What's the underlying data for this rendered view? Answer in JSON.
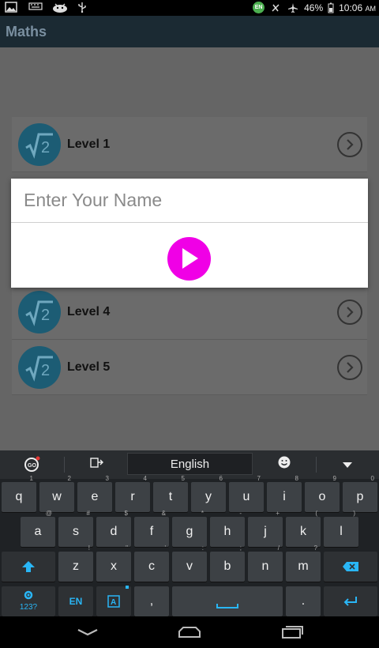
{
  "status_bar": {
    "battery": "46%",
    "time": "10:06",
    "ampm": "AM",
    "lang_badge": "EN",
    "icons_left": [
      "image-icon",
      "keyboard-icon",
      "android-icon",
      "usb-icon"
    ],
    "icons_right": [
      "no-vibrate-icon",
      "airplane-icon",
      "battery-icon"
    ]
  },
  "action_bar": {
    "title": "Maths"
  },
  "levels": [
    {
      "label": "Level 1"
    },
    {
      "label": "Level 4"
    },
    {
      "label": "Level 5"
    }
  ],
  "dialog": {
    "placeholder": "Enter Your Name",
    "value": ""
  },
  "keyboard": {
    "language_label": "English",
    "row1": [
      {
        "k": "q",
        "s": "1"
      },
      {
        "k": "w",
        "s": "2"
      },
      {
        "k": "e",
        "s": "3"
      },
      {
        "k": "r",
        "s": "4"
      },
      {
        "k": "t",
        "s": "5"
      },
      {
        "k": "y",
        "s": "6"
      },
      {
        "k": "u",
        "s": "7"
      },
      {
        "k": "i",
        "s": "8"
      },
      {
        "k": "o",
        "s": "9"
      },
      {
        "k": "p",
        "s": "0"
      }
    ],
    "row2": [
      {
        "k": "a",
        "s": "@"
      },
      {
        "k": "s",
        "s": "#"
      },
      {
        "k": "d",
        "s": "$"
      },
      {
        "k": "f",
        "s": "&"
      },
      {
        "k": "g",
        "s": "*"
      },
      {
        "k": "h",
        "s": "-"
      },
      {
        "k": "j",
        "s": "+"
      },
      {
        "k": "k",
        "s": "("
      },
      {
        "k": "l",
        "s": ")"
      }
    ],
    "row3": [
      {
        "k": "z",
        "s": "!"
      },
      {
        "k": "x",
        "s": "\""
      },
      {
        "k": "c",
        "s": "'"
      },
      {
        "k": "v",
        "s": ":"
      },
      {
        "k": "b",
        "s": ";"
      },
      {
        "k": "n",
        "s": "/"
      },
      {
        "k": "m",
        "s": "?"
      }
    ],
    "symbols_label": "123?",
    "lang_key": "EN",
    "comma": ",",
    "period": "."
  },
  "colors": {
    "accent": "#f000e6",
    "icon_bg": "#1c5c74",
    "overlay": "#656565",
    "action_bar": "#1b2a33"
  }
}
